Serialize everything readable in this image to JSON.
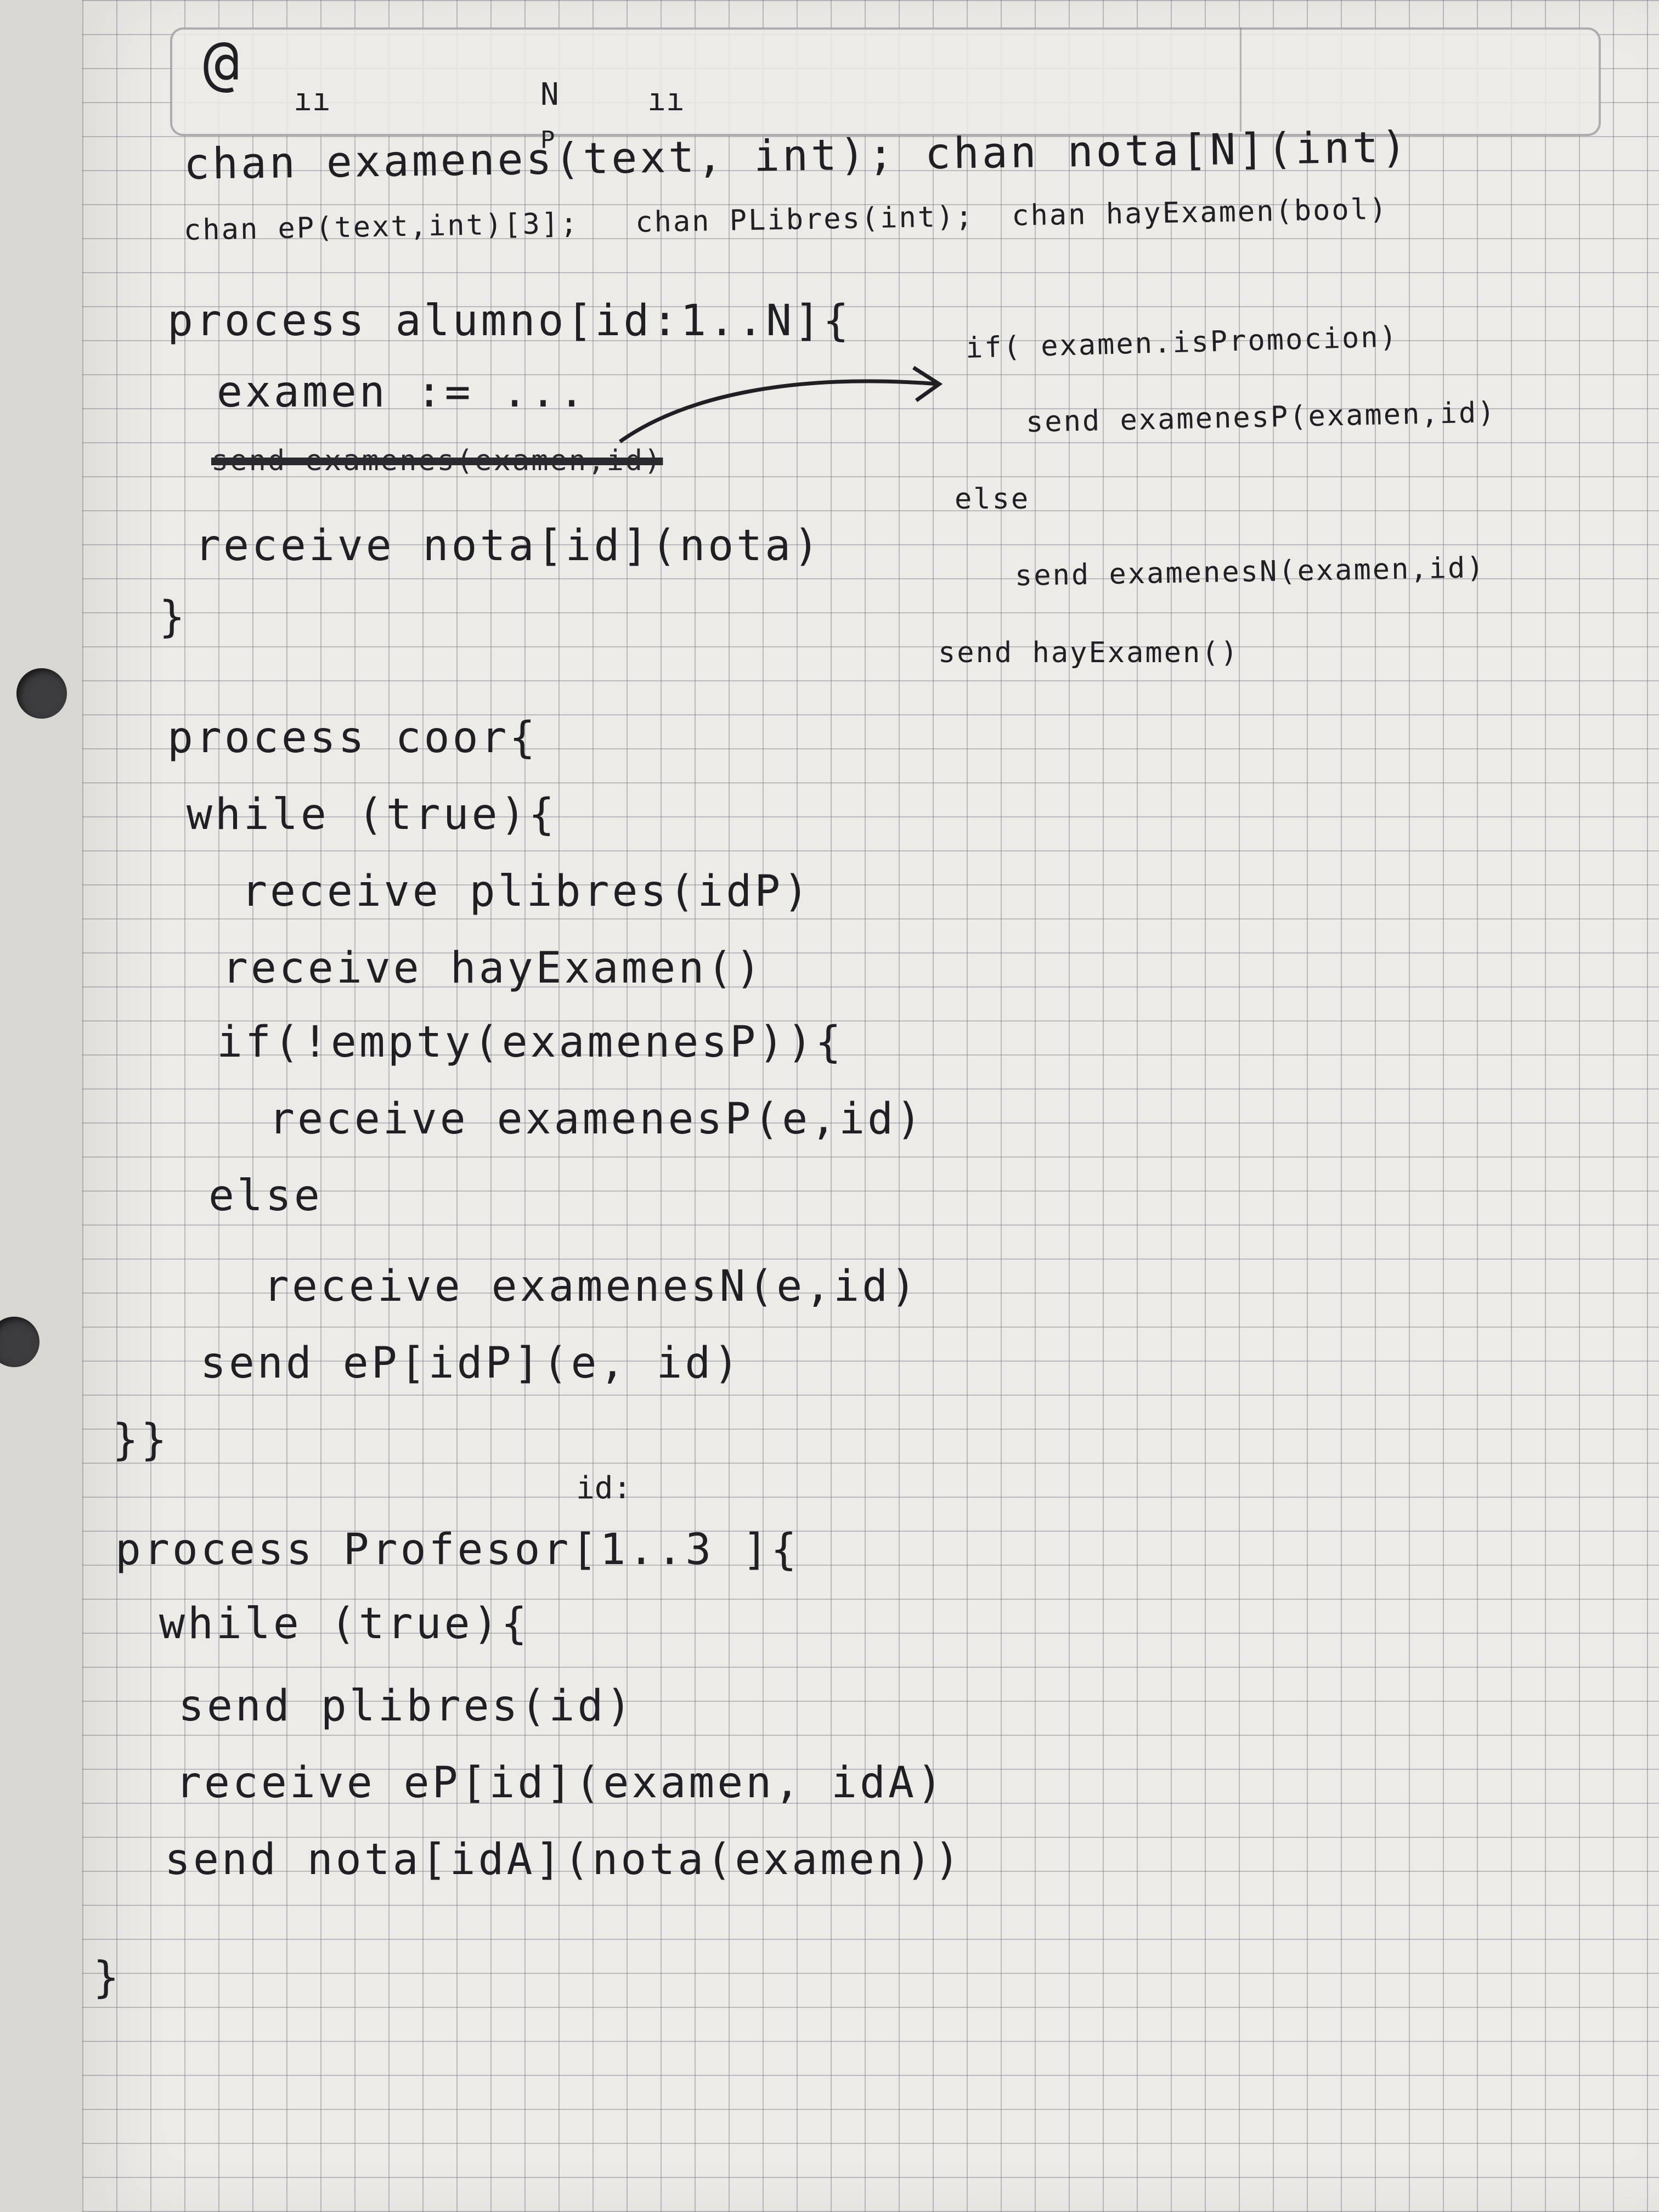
{
  "header": {
    "doodle": "@",
    "marks": [
      "ıı",
      "N",
      "P",
      "ıı"
    ]
  },
  "lines": {
    "decl1": "chan examenes(text, int); chan nota[N](int)",
    "decl2": "chan eP(text,int)[3];   chan PLibres(int);  chan hayExamen(bool)",
    "alumno_head": "process alumno[id:1..N]{",
    "alumno_1": "examen := ...",
    "alumno_struck": "send examenes(examen,id)",
    "alumno_2": "receive nota[id](nota)",
    "alumno_close": "}",
    "side_1": "if( examen.isPromocion)",
    "side_2": "send examenesP(examen,id)",
    "side_3": "else",
    "side_4": "send examenesN(examen,id)",
    "side_5": "send hayExamen()",
    "coor_head": "process coor{",
    "coor_1": "while (true){",
    "coor_2": "receive plibres(idP)",
    "coor_3": "receive hayExamen()",
    "coor_4": "if(!empty(examenesP)){",
    "coor_5": "receive examenesP(e,id)",
    "coor_6": "else",
    "coor_7": "receive examenesN(e,id)",
    "coor_8": "send eP[idP](e, id)",
    "coor_close": "}}",
    "prof_note": "id:",
    "prof_head": "process Profesor[1..3 ]{",
    "prof_1": "while (true){",
    "prof_2": "send plibres(id)",
    "prof_3": "receive eP[id](examen, idA)",
    "prof_4": "send nota[idA](nota(examen))",
    "prof_close": "}"
  },
  "colors": {
    "ink": "#202024",
    "paper": "#ecebe7",
    "grid": "#6e6e78"
  }
}
